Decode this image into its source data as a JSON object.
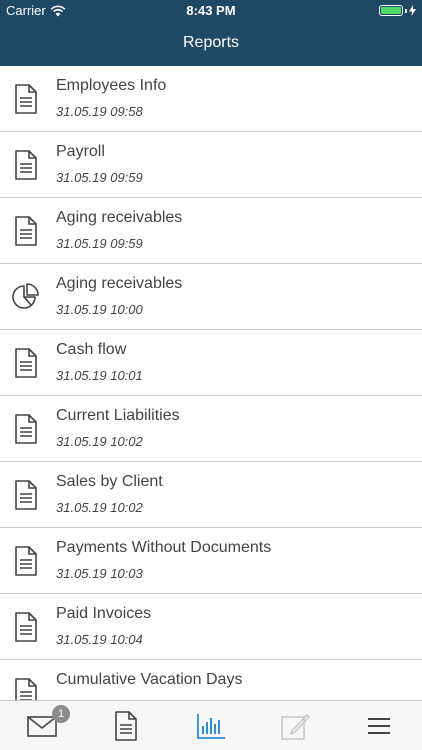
{
  "status_bar": {
    "carrier": "Carrier",
    "time": "8:43 PM"
  },
  "header": {
    "title": "Reports"
  },
  "reports": [
    {
      "name": "Employees Info",
      "date": "31.05.19 09:58",
      "icon": "document-icon"
    },
    {
      "name": "Payroll",
      "date": "31.05.19 09:59",
      "icon": "document-icon"
    },
    {
      "name": "Aging receivables",
      "date": "31.05.19 09:59",
      "icon": "document-icon"
    },
    {
      "name": "Aging receivables",
      "date": "31.05.19 10:00",
      "icon": "pie-chart-icon"
    },
    {
      "name": "Cash flow",
      "date": "31.05.19 10:01",
      "icon": "document-icon"
    },
    {
      "name": "Current Liabilities",
      "date": "31.05.19 10:02",
      "icon": "document-icon"
    },
    {
      "name": "Sales by Client",
      "date": "31.05.19 10:02",
      "icon": "document-icon"
    },
    {
      "name": "Payments Without Documents",
      "date": "31.05.19 10:03",
      "icon": "document-icon"
    },
    {
      "name": "Paid Invoices",
      "date": "31.05.19 10:04",
      "icon": "document-icon"
    },
    {
      "name": "Cumulative Vacation Days",
      "date": "",
      "icon": "document-icon"
    }
  ],
  "tabbar": {
    "messages_badge": "1",
    "active_tab": "reports",
    "tabs": [
      "mail-icon",
      "document-icon",
      "bar-chart-icon",
      "edit-icon",
      "menu-icon"
    ]
  },
  "colors": {
    "header": "#1f4864",
    "active_tab": "#2a8fd6",
    "inactive_tab": "#444444",
    "disabled_tab": "#c8c8c8"
  }
}
